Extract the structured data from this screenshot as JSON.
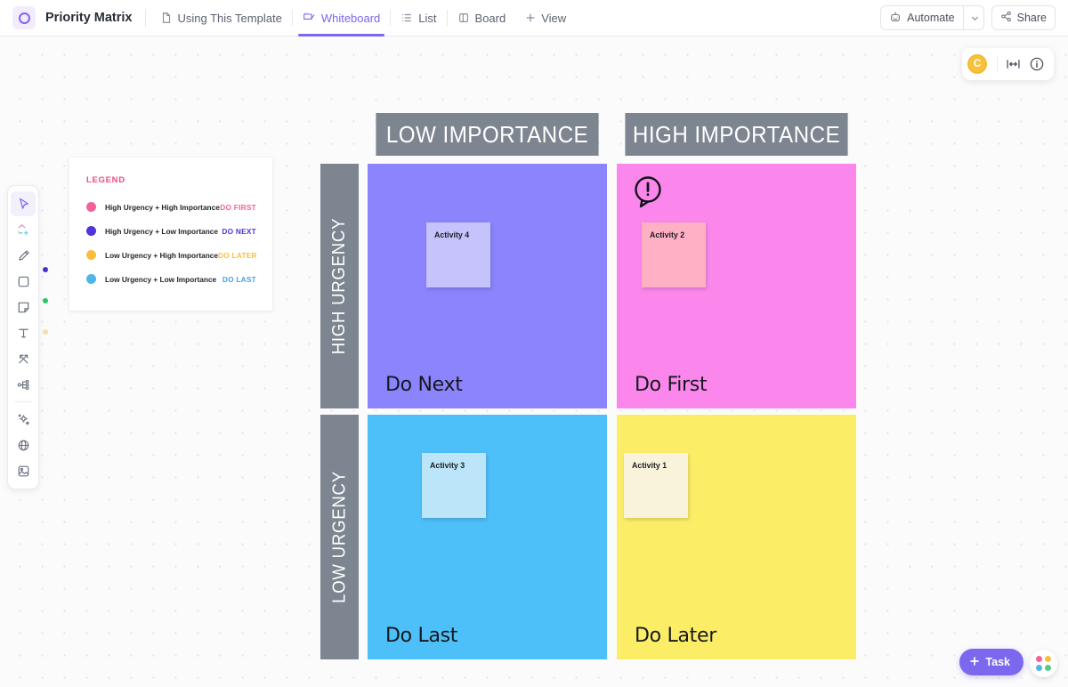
{
  "topbar": {
    "logo_icon": "clickup-circle-logo",
    "doc_title": "Priority Matrix",
    "tabs": [
      {
        "label": "Using This Template",
        "icon": "doc-icon",
        "active": false
      },
      {
        "label": "Whiteboard",
        "icon": "whiteboard-icon",
        "active": true
      },
      {
        "label": "List",
        "icon": "list-icon",
        "active": false
      },
      {
        "label": "Board",
        "icon": "board-icon",
        "active": false
      },
      {
        "label": "View",
        "icon": "plus-icon",
        "active": false
      }
    ],
    "automate_label": "Automate",
    "automate_icon": "robot-icon",
    "automate_chevron_icon": "chevron-down-icon",
    "share_label": "Share",
    "share_icon": "share-icon"
  },
  "toolbar": {
    "tools": [
      {
        "name": "select-tool",
        "icon": "cursor-icon",
        "selected": true
      },
      {
        "name": "shapes-tool",
        "icon": "shapes-plus-icon",
        "selected": false
      },
      {
        "name": "pen-tool",
        "icon": "pen-icon",
        "selected": false
      },
      {
        "name": "rectangle-tool",
        "icon": "square-icon",
        "selected": false
      },
      {
        "name": "sticky-note-tool",
        "icon": "sticky-note-icon",
        "selected": false
      },
      {
        "name": "text-tool",
        "icon": "text-t-icon",
        "selected": false
      },
      {
        "name": "connector-tool",
        "icon": "arrows-icon",
        "selected": false
      },
      {
        "name": "mindmap-tool",
        "icon": "mindmap-icon",
        "selected": false
      },
      {
        "name": "ai-tool",
        "icon": "magic-wand-icon",
        "selected": false
      },
      {
        "name": "embed-tool",
        "icon": "globe-icon",
        "selected": false
      },
      {
        "name": "image-tool",
        "icon": "image-icon",
        "selected": false
      }
    ],
    "color_markers": [
      {
        "name": "marker-purple",
        "color": "#4a2fd6"
      },
      {
        "name": "marker-green",
        "color": "#29c762"
      },
      {
        "name": "marker-yellow",
        "color": "#f0e2a8"
      }
    ]
  },
  "float_chip": {
    "avatar_initial": "C",
    "avatar_color": "#f5c33b",
    "fit_icon": "fit-to-screen-icon",
    "info_icon": "info-icon"
  },
  "legend": {
    "title": "LEGEND",
    "title_color": "#ee4b8b",
    "rows": [
      {
        "dot_color": "#f4619b",
        "label": "High Urgency + High Importance",
        "tag": "DO FIRST",
        "tag_color": "#f4619b"
      },
      {
        "dot_color": "#5135d8",
        "label": "High Urgency + Low Importance",
        "tag": "DO NEXT",
        "tag_color": "#5135d8"
      },
      {
        "dot_color": "#fbbe3c",
        "label": "Low Urgency + High Importance",
        "tag": "DO LATER",
        "tag_color": "#fbbe3c"
      },
      {
        "dot_color": "#4db5e8",
        "label": "Low Urgency + Low Importance",
        "tag": "DO LAST",
        "tag_color": "#4d9fe0"
      }
    ]
  },
  "matrix": {
    "col_headers": [
      "LOW IMPORTANCE",
      "HIGH IMPORTANCE"
    ],
    "row_headers": [
      "HIGH URGENCY",
      "LOW URGENCY"
    ],
    "header_bg": "#7d8590",
    "quadrants": [
      {
        "name": "quadrant-do-next",
        "label": "Do Next",
        "bg": "#8b84fd",
        "sticky": {
          "text": "Activity 4",
          "bg": "#c6c3fc"
        },
        "alert": false
      },
      {
        "name": "quadrant-do-first",
        "label": "Do First",
        "bg": "#fb87ec",
        "sticky": {
          "text": "Activity 2",
          "bg": "#ffb0c4"
        },
        "alert": true,
        "alert_icon": "exclamation-speech-bubble-icon"
      },
      {
        "name": "quadrant-do-last",
        "label": "Do Last",
        "bg": "#4dbff9",
        "sticky": {
          "text": "Activity 3",
          "bg": "#bce5fa"
        },
        "alert": false
      },
      {
        "name": "quadrant-do-later",
        "label": "Do Later",
        "bg": "#fbee66",
        "sticky": {
          "text": "Activity 1",
          "bg": "#faf3dc"
        },
        "alert": false
      }
    ]
  },
  "bottom": {
    "task_label": "Task",
    "task_plus_icon": "plus-icon",
    "task_color": "#7b68ee",
    "apps_icon": "apps-grid-icon"
  }
}
